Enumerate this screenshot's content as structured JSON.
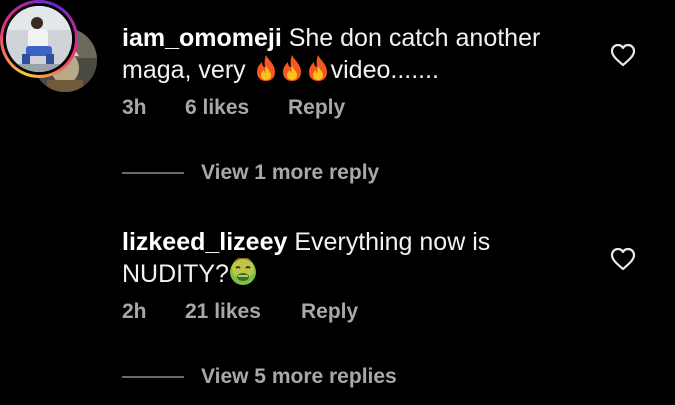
{
  "comments": [
    {
      "username": "iam_omomeji",
      "text_before": " She don catch another maga, very ",
      "emojis": [
        "fire",
        "fire",
        "fire"
      ],
      "text_after": "video.......",
      "time": "3h",
      "likes": "6 likes",
      "reply_label": "Reply",
      "view_more": "View 1 more reply"
    },
    {
      "username": "lizkeed_lizeey",
      "text_before": " Everything now is NUDITY?",
      "emojis": [
        "nauseated-face"
      ],
      "text_after": "",
      "time": "2h",
      "likes": "21 likes",
      "reply_label": "Reply",
      "view_more": "View 5 more replies"
    }
  ],
  "colors": {
    "background": "#000000",
    "text": "#ffffff",
    "secondary": "#a8a8a8",
    "divider": "#6a6a6a"
  },
  "icons": [
    "heart-icon",
    "fire-emoji",
    "nauseated-face-emoji"
  ]
}
